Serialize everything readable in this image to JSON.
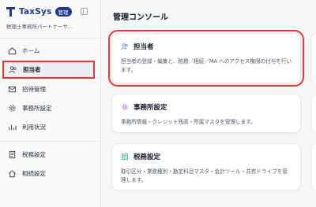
{
  "brand": {
    "name": "TaxSys",
    "badge": "管理"
  },
  "org_name": "税理士事務所パートナーサ...",
  "sidebar": {
    "items": [
      {
        "label": "ホーム"
      },
      {
        "label": "担当者"
      },
      {
        "label": "招待管理"
      },
      {
        "label": "事務所設定"
      },
      {
        "label": "利用状況"
      },
      {
        "label": "税務設定"
      },
      {
        "label": "相続設定"
      }
    ]
  },
  "main": {
    "title": "管理コンソール",
    "cards": [
      {
        "title": "担当者",
        "desc": "担当者の登録・編集と、税務／相続／MA へのアクセス権限の付与を行います。"
      },
      {
        "title": "事務所設定",
        "desc": "事務所情報・クレジット残高・所属マスタを管理します。"
      },
      {
        "title": "税務設定",
        "desc": "取引区分・業務種別・勘定科目マスタ・会計ツール・共有ドライブを管理します。"
      }
    ]
  },
  "colors": {
    "brand": "#1e3a8a",
    "highlight": "#e53935",
    "settings_icon": "#a855f7",
    "tax_icon": "#10b981",
    "staff_icon": "#3b82f6"
  }
}
